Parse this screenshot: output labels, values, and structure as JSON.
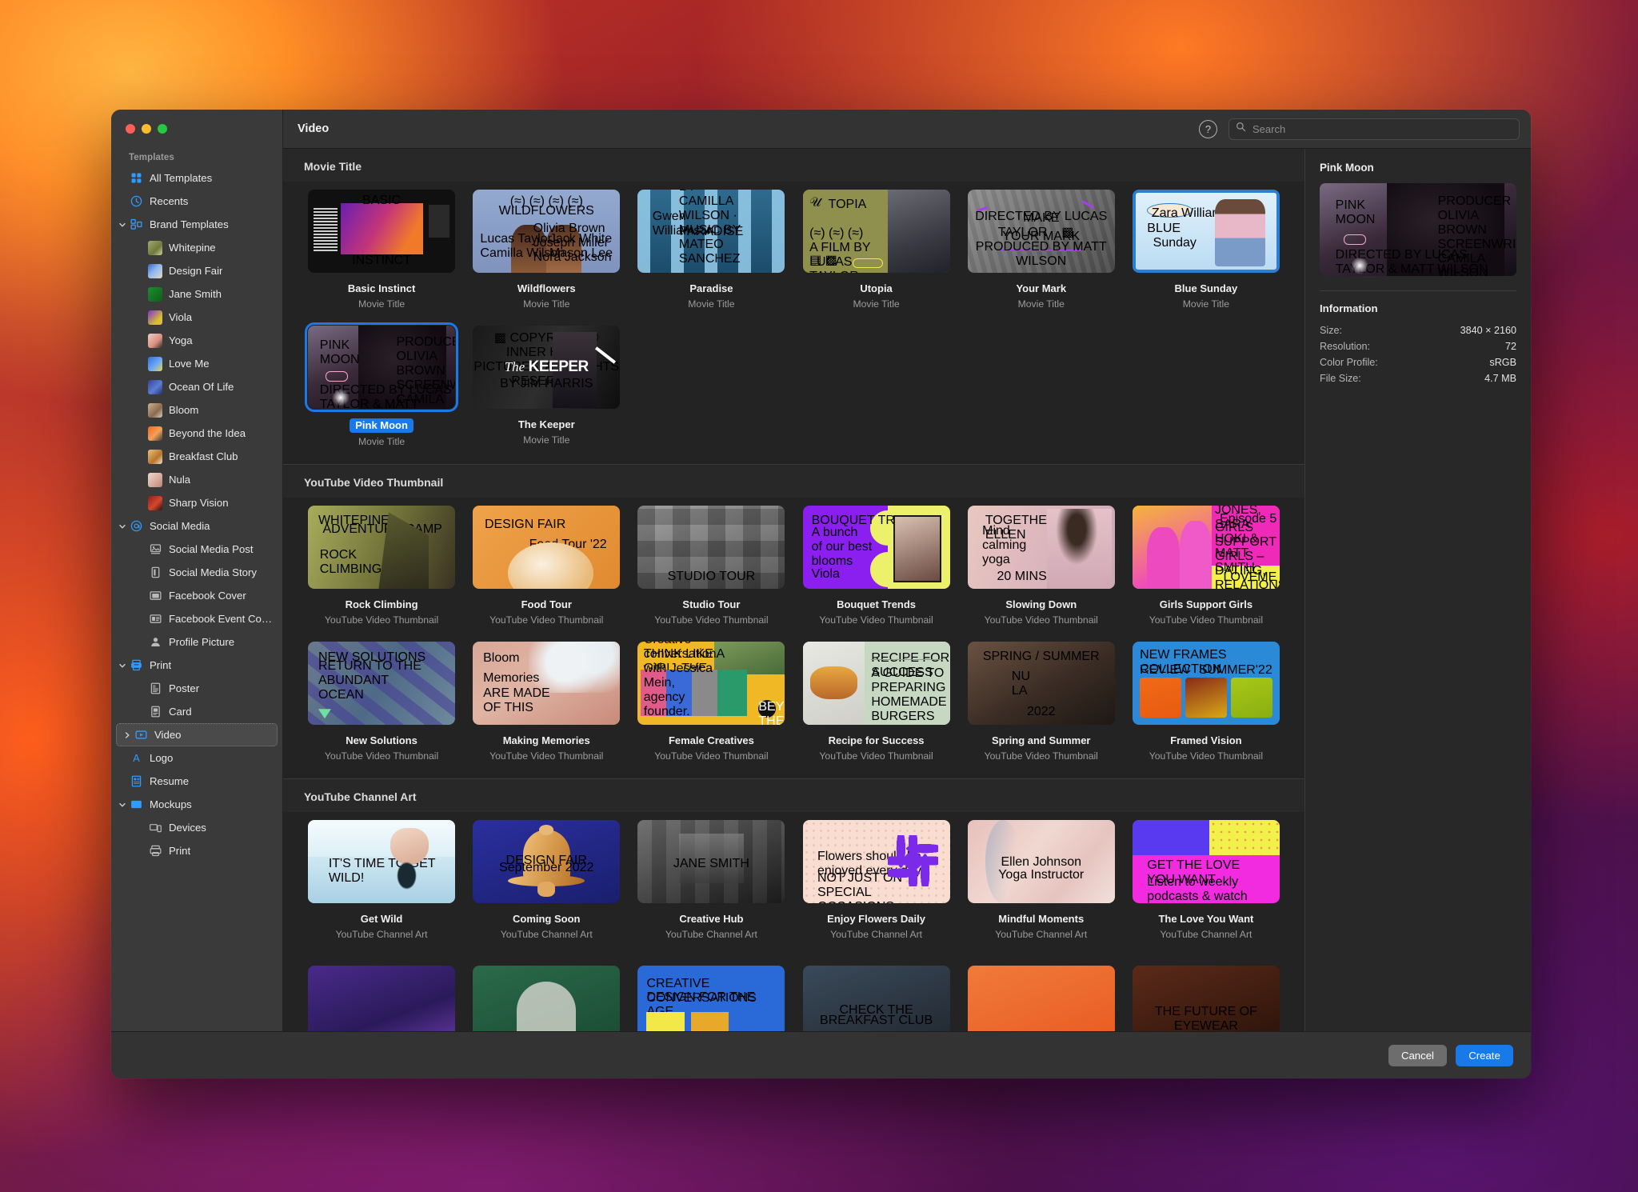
{
  "window": {
    "title": "Video",
    "search_placeholder": "Search",
    "search_value": "",
    "help_label": "?"
  },
  "sidebar": {
    "header": "Templates",
    "items": [
      {
        "label": "All Templates",
        "icon": "grid-icon",
        "level": 1,
        "twisty": "none",
        "selected": false
      },
      {
        "label": "Recents",
        "icon": "clock-icon",
        "level": 1,
        "twisty": "none",
        "selected": false
      },
      {
        "label": "Brand Templates",
        "icon": "brand-icon",
        "level": 0,
        "twisty": "down",
        "selected": false
      },
      {
        "label": "Whitepine",
        "icon": "thumb-whitepine",
        "level": 2,
        "twisty": "none",
        "selected": false
      },
      {
        "label": "Design Fair",
        "icon": "thumb-designfair",
        "level": 2,
        "twisty": "none",
        "selected": false
      },
      {
        "label": "Jane Smith",
        "icon": "thumb-janesmith",
        "level": 2,
        "twisty": "none",
        "selected": false
      },
      {
        "label": "Viola",
        "icon": "thumb-viola",
        "level": 2,
        "twisty": "none",
        "selected": false
      },
      {
        "label": "Yoga",
        "icon": "thumb-yoga",
        "level": 2,
        "twisty": "none",
        "selected": false
      },
      {
        "label": "Love Me",
        "icon": "thumb-loveme",
        "level": 2,
        "twisty": "none",
        "selected": false
      },
      {
        "label": "Ocean Of Life",
        "icon": "thumb-ocean",
        "level": 2,
        "twisty": "none",
        "selected": false
      },
      {
        "label": "Bloom",
        "icon": "thumb-bloom",
        "level": 2,
        "twisty": "none",
        "selected": false
      },
      {
        "label": "Beyond the Idea",
        "icon": "thumb-beyond",
        "level": 2,
        "twisty": "none",
        "selected": false
      },
      {
        "label": "Breakfast Club",
        "icon": "thumb-breakfast",
        "level": 2,
        "twisty": "none",
        "selected": false
      },
      {
        "label": "Nula",
        "icon": "thumb-nula",
        "level": 2,
        "twisty": "none",
        "selected": false
      },
      {
        "label": "Sharp Vision",
        "icon": "thumb-sharp",
        "level": 2,
        "twisty": "none",
        "selected": false
      },
      {
        "label": "Social Media",
        "icon": "at-icon",
        "level": 0,
        "twisty": "down",
        "selected": false
      },
      {
        "label": "Social Media Post",
        "icon": "photo-icon",
        "level": 2,
        "twisty": "none",
        "selected": false
      },
      {
        "label": "Social Media Story",
        "icon": "story-icon",
        "level": 2,
        "twisty": "none",
        "selected": false
      },
      {
        "label": "Facebook Cover",
        "icon": "cover-icon",
        "level": 2,
        "twisty": "none",
        "selected": false
      },
      {
        "label": "Facebook Event Co…",
        "icon": "event-icon",
        "level": 2,
        "twisty": "none",
        "selected": false
      },
      {
        "label": "Profile Picture",
        "icon": "person-icon",
        "level": 2,
        "twisty": "none",
        "selected": false
      },
      {
        "label": "Print",
        "icon": "printer-icon",
        "level": 0,
        "twisty": "down",
        "selected": false
      },
      {
        "label": "Poster",
        "icon": "poster-icon",
        "level": 2,
        "twisty": "none",
        "selected": false
      },
      {
        "label": "Card",
        "icon": "card-icon",
        "level": 2,
        "twisty": "none",
        "selected": false
      },
      {
        "label": "Video",
        "icon": "video-icon",
        "level": 0,
        "twisty": "right",
        "selected": true
      },
      {
        "label": "Logo",
        "icon": "logo-a-icon",
        "level": 1,
        "twisty": "none",
        "selected": false
      },
      {
        "label": "Resume",
        "icon": "resume-icon",
        "level": 1,
        "twisty": "none",
        "selected": false
      },
      {
        "label": "Mockups",
        "icon": "mockups-icon",
        "level": 0,
        "twisty": "down",
        "selected": false
      },
      {
        "label": "Devices",
        "icon": "devices-icon",
        "level": 2,
        "twisty": "none",
        "selected": false
      },
      {
        "label": "Print",
        "icon": "printer2-icon",
        "level": 2,
        "twisty": "none",
        "selected": false
      }
    ]
  },
  "sections": [
    {
      "title": "Movie Title",
      "items": [
        {
          "name": "Basic Instinct",
          "kind": "Movie Title",
          "art": "basic-instinct",
          "selected": false
        },
        {
          "name": "Wildflowers",
          "kind": "Movie Title",
          "art": "wildflowers",
          "selected": false
        },
        {
          "name": "Paradise",
          "kind": "Movie Title",
          "art": "paradise",
          "selected": false
        },
        {
          "name": "Utopia",
          "kind": "Movie Title",
          "art": "utopia",
          "selected": false
        },
        {
          "name": "Your Mark",
          "kind": "Movie Title",
          "art": "your-mark",
          "selected": false
        },
        {
          "name": "Blue Sunday",
          "kind": "Movie Title",
          "art": "blue-sunday",
          "selected": false
        },
        {
          "name": "Pink Moon",
          "kind": "Movie Title",
          "art": "pink-moon",
          "selected": true
        },
        {
          "name": "The Keeper",
          "kind": "Movie Title",
          "art": "the-keeper",
          "selected": false
        }
      ]
    },
    {
      "title": "YouTube Video Thumbnail",
      "items": [
        {
          "name": "Rock Climbing",
          "kind": "YouTube Video Thumbnail",
          "art": "rock-climbing",
          "selected": false
        },
        {
          "name": "Food Tour",
          "kind": "YouTube Video Thumbnail",
          "art": "food-tour",
          "selected": false
        },
        {
          "name": "Studio Tour",
          "kind": "YouTube Video Thumbnail",
          "art": "studio-tour",
          "selected": false
        },
        {
          "name": "Bouquet Trends",
          "kind": "YouTube Video Thumbnail",
          "art": "bouquet-trends",
          "selected": false
        },
        {
          "name": "Slowing Down",
          "kind": "YouTube Video Thumbnail",
          "art": "slowing-down",
          "selected": false
        },
        {
          "name": "Girls Support Girls",
          "kind": "YouTube Video Thumbnail",
          "art": "girls-support",
          "selected": false
        },
        {
          "name": "New Solutions",
          "kind": "YouTube Video Thumbnail",
          "art": "new-solutions",
          "selected": false
        },
        {
          "name": "Making Memories",
          "kind": "YouTube Video Thumbnail",
          "art": "making-memories",
          "selected": false
        },
        {
          "name": "Female Creatives",
          "kind": "YouTube Video Thumbnail",
          "art": "female-creatives",
          "selected": false
        },
        {
          "name": "Recipe for Success",
          "kind": "YouTube Video Thumbnail",
          "art": "recipe-success",
          "selected": false
        },
        {
          "name": "Spring and Summer",
          "kind": "YouTube Video Thumbnail",
          "art": "spring-summer",
          "selected": false
        },
        {
          "name": "Framed Vision",
          "kind": "YouTube Video Thumbnail",
          "art": "framed-vision",
          "selected": false
        }
      ]
    },
    {
      "title": "YouTube Channel Art",
      "items": [
        {
          "name": "Get Wild",
          "kind": "YouTube Channel Art",
          "art": "get-wild",
          "selected": false
        },
        {
          "name": "Coming Soon",
          "kind": "YouTube Channel Art",
          "art": "coming-soon",
          "selected": false
        },
        {
          "name": "Creative Hub",
          "kind": "YouTube Channel Art",
          "art": "creative-hub",
          "selected": false
        },
        {
          "name": "Enjoy Flowers Daily",
          "kind": "YouTube Channel Art",
          "art": "enjoy-flowers",
          "selected": false
        },
        {
          "name": "Mindful Moments",
          "kind": "YouTube Channel Art",
          "art": "mindful-moments",
          "selected": false
        },
        {
          "name": "The Love You Want",
          "kind": "YouTube Channel Art",
          "art": "love-you-want",
          "selected": false
        }
      ]
    }
  ],
  "partial_row": [
    {
      "art": "partial-purple"
    },
    {
      "art": "partial-green"
    },
    {
      "art": "partial-blue"
    },
    {
      "art": "partial-breakfast"
    },
    {
      "art": "partial-orange"
    },
    {
      "art": "partial-dark"
    }
  ],
  "inspector": {
    "title": "Pink Moon",
    "preview_art": "pink-moon",
    "info_heading": "Information",
    "rows": [
      {
        "label": "Size:",
        "value": "3840 × 2160"
      },
      {
        "label": "Resolution:",
        "value": "72"
      },
      {
        "label": "Color Profile:",
        "value": "sRGB"
      },
      {
        "label": "File Size:",
        "value": "4.7 MB"
      }
    ]
  },
  "footer": {
    "cancel_label": "Cancel",
    "create_label": "Create"
  },
  "colors": {
    "accent": "#1a79e8",
    "sidebar_bg": "#3a3a3a",
    "main_bg": "#232323"
  }
}
